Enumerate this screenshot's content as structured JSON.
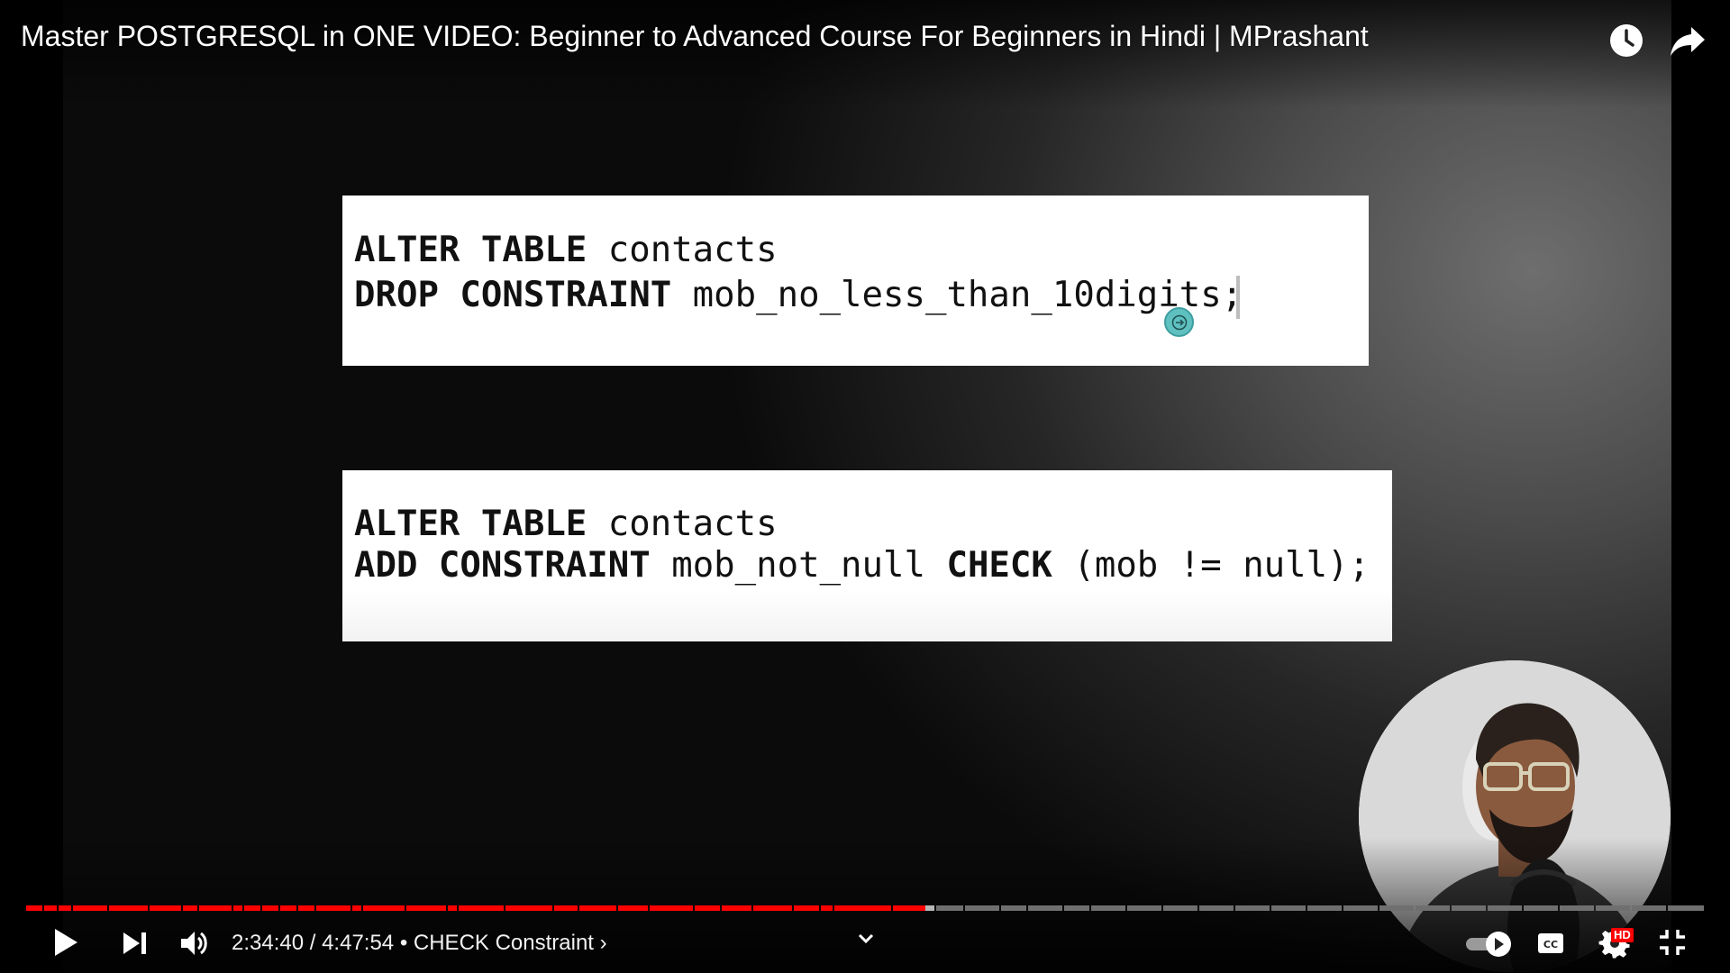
{
  "video": {
    "title": "Master POSTGRESQL in ONE VIDEO: Beginner to Advanced Course For Beginners in Hindi | MPrashant",
    "top_icons": [
      "clock-icon",
      "share-icon"
    ]
  },
  "slide": {
    "block1": {
      "line1_kw": "ALTER TABLE",
      "line1_rest": " contacts",
      "line2_kw": "DROP CONSTRAINT",
      "line2_rest": " mob_no_less_than_10digits;"
    },
    "block2": {
      "line1_kw": "ALTER TABLE",
      "line1_rest": " contacts",
      "line2_kw1": "ADD CONSTRAINT",
      "line2_mid": " mob_not_null ",
      "line2_kw2": "CHECK",
      "line2_rest": " (mob != null);"
    }
  },
  "player": {
    "current_time": "2:34:40",
    "duration": "4:47:54",
    "chapter": "CHECK Constraint",
    "time_display": "2:34:40 / 4:47:54 • CHECK Constraint ›",
    "progress_fraction": 0.536,
    "hd_label": "HD",
    "colors": {
      "played": "#ff0000",
      "buffered": "#b7b7b7",
      "unplayed": "#6f6f6f"
    },
    "icons": [
      "play-icon",
      "next-icon",
      "volume-icon",
      "chevron-down-icon",
      "autoplay-toggle-icon",
      "captions-icon",
      "settings-icon",
      "exit-fullscreen-icon"
    ]
  }
}
